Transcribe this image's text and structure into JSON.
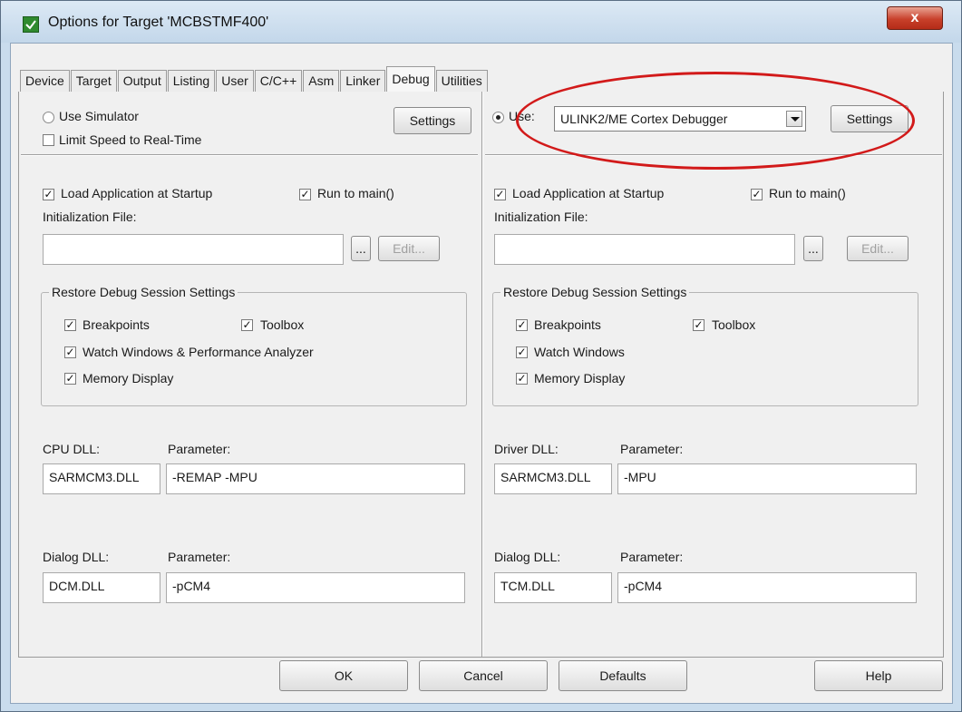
{
  "window": {
    "title": "Options for Target 'MCBSTMF400'",
    "close_symbol": "x"
  },
  "tabs": [
    "Device",
    "Target",
    "Output",
    "Listing",
    "User",
    "C/C++",
    "Asm",
    "Linker",
    "Debug",
    "Utilities"
  ],
  "active_tab": "Debug",
  "left": {
    "use_simulator_label": "Use Simulator",
    "limit_speed_label": "Limit Speed to Real-Time",
    "settings_label": "Settings",
    "load_app_label": "Load Application at Startup",
    "run_to_main_label": "Run to main()",
    "init_file_label": "Initialization File:",
    "init_file_value": "",
    "browse_label": "...",
    "edit_label": "Edit...",
    "restore_group_label": "Restore Debug Session Settings",
    "breakpoints_label": "Breakpoints",
    "toolbox_label": "Toolbox",
    "watch_label": "Watch Windows & Performance Analyzer",
    "memory_label": "Memory Display",
    "cpu_dll_label": "CPU DLL:",
    "cpu_param_label": "Parameter:",
    "cpu_dll_value": "SARMCM3.DLL",
    "cpu_param_value": "-REMAP -MPU",
    "dialog_dll_label": "Dialog DLL:",
    "dialog_param_label": "Parameter:",
    "dialog_dll_value": "DCM.DLL",
    "dialog_param_value": "-pCM4"
  },
  "right": {
    "use_label": "Use:",
    "debugger_value": "ULINK2/ME Cortex Debugger",
    "settings_label": "Settings",
    "load_app_label": "Load Application at Startup",
    "run_to_main_label": "Run to main()",
    "init_file_label": "Initialization File:",
    "init_file_value": "",
    "browse_label": "...",
    "edit_label": "Edit...",
    "restore_group_label": "Restore Debug Session Settings",
    "breakpoints_label": "Breakpoints",
    "toolbox_label": "Toolbox",
    "watch_label": "Watch Windows",
    "memory_label": "Memory Display",
    "driver_dll_label": "Driver DLL:",
    "driver_param_label": "Parameter:",
    "driver_dll_value": "SARMCM3.DLL",
    "driver_param_value": "-MPU",
    "dialog_dll_label": "Dialog DLL:",
    "dialog_param_label": "Parameter:",
    "dialog_dll_value": "TCM.DLL",
    "dialog_param_value": "-pCM4"
  },
  "footer": {
    "ok_label": "OK",
    "cancel_label": "Cancel",
    "defaults_label": "Defaults",
    "help_label": "Help"
  },
  "check_mark": "✓",
  "colors": {
    "highlight_ellipse": "#d21a1a",
    "title_bar": "#c9dced"
  }
}
